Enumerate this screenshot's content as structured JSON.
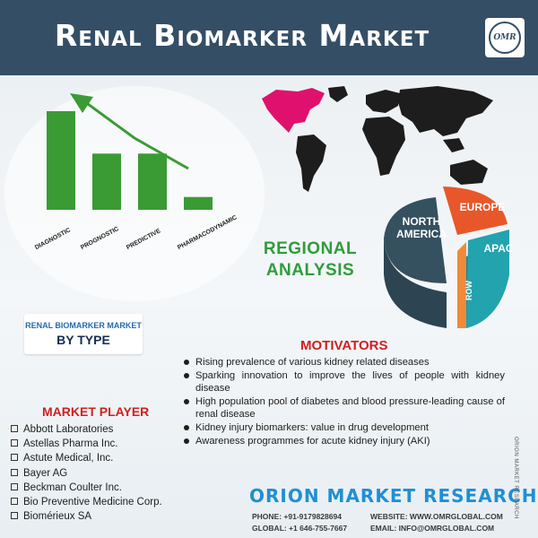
{
  "header": {
    "title": "Renal Biomarker Market",
    "logo_text": "OMR"
  },
  "type_chart": {
    "caption_line1": "RENAL BIOMARKER MARKET",
    "caption_line2": "BY TYPE",
    "colors": {
      "bar": "#3a9b35",
      "arrow": "#3a9b35"
    }
  },
  "chart_data": {
    "type": "bar",
    "categories": [
      "DIAGNOSTIC",
      "PROGNOSTIC",
      "PREDICTIVE",
      "PHARMACODYNAMIC"
    ],
    "values": [
      100,
      57,
      57,
      13
    ],
    "title": "",
    "xlabel": "",
    "ylabel": ""
  },
  "regional": {
    "title_line1": "REGIONAL",
    "title_line2": "ANALYSIS",
    "regions": [
      {
        "name_line1": "NORTH",
        "name_line2": "AMERICA",
        "color": "#35505f"
      },
      {
        "name_line1": "EUROPE",
        "name_line2": "",
        "color": "#e8572a"
      },
      {
        "name_line1": "APAC",
        "name_line2": "",
        "color": "#23a3ad"
      },
      {
        "name_line1": "ROW",
        "name_line2": "",
        "color": "#f08a3a"
      }
    ],
    "map_highlight_color": "#e0116e"
  },
  "motivators": {
    "title": "MOTIVATORS",
    "items": [
      "Rising prevalence of various kidney related diseases",
      "Sparking innovation to improve the lives of people with kidney disease",
      "High population pool of diabetes and blood pressure-leading cause of renal disease",
      "Kidney injury biomarkers: value in drug development",
      "Awareness programmes for acute kidney injury (AKI)"
    ]
  },
  "market_player": {
    "title": "MARKET PLAYER",
    "items": [
      "Abbott Laboratories",
      "Astellas Pharma Inc.",
      "Astute Medical, Inc.",
      "Bayer AG",
      "Beckman Coulter Inc.",
      "Bio Preventive Medicine Corp.",
      "Biomérieux SA"
    ]
  },
  "footer": {
    "brand": "ORION MARKET RESEARCH",
    "phone": "PHONE:  +91-9179828694",
    "global": "GLOBAL: +1 646-755-7667",
    "website": "WEBSITE: WWW.OMRGLOBAL.COM",
    "email": "EMAIL:  INFO@OMRGLOBAL.COM",
    "side_text": "ORION MARKET RESEARCH"
  }
}
